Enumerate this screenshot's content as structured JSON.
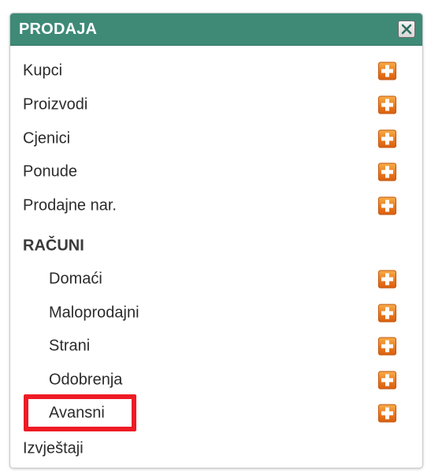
{
  "panel": {
    "title": "PRODAJA",
    "header_color": "#3e8a77",
    "close_icon": "close-icon"
  },
  "menu": {
    "kupci": "Kupci",
    "proizvodi": "Proizvodi",
    "cjenici": "Cjenici",
    "ponude": "Ponude",
    "prodajne_nar": "Prodajne nar.",
    "racuni_header": "RAČUNI",
    "domaci": "Domaći",
    "maloprodajni": "Maloprodajni",
    "strani": "Strani",
    "odobrenja": "Odobrenja",
    "avansni": "Avansni",
    "izvjestaji": "Izvještaji"
  },
  "icons": {
    "add": "add-icon",
    "add_color": "#e8741b"
  },
  "highlight": {
    "target": "Avansni",
    "color": "#ee1b24"
  }
}
